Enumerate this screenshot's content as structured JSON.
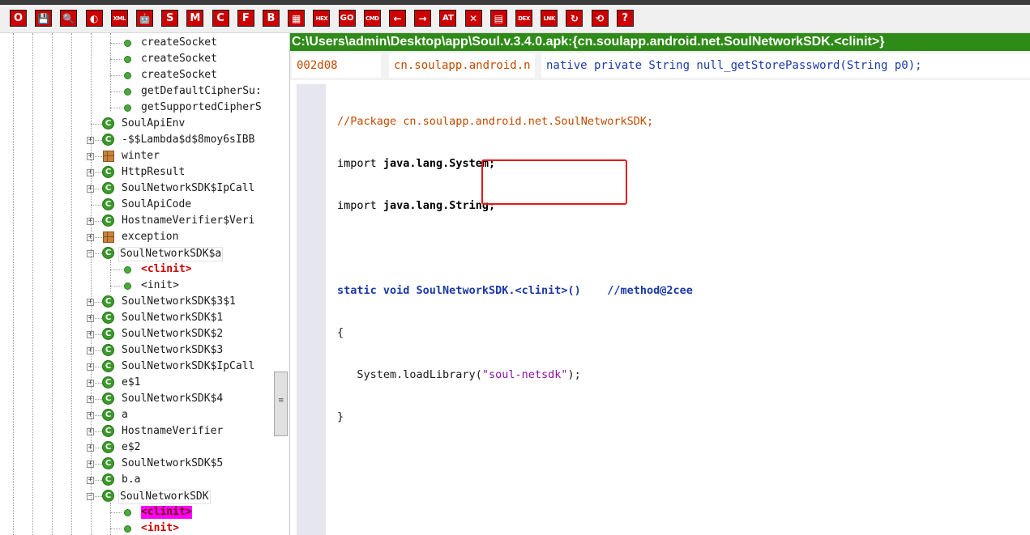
{
  "toolbar": {
    "buttons": [
      {
        "label": "O",
        "name": "open-button"
      },
      {
        "label": "💾",
        "name": "save-icon"
      },
      {
        "label": "🔍",
        "name": "search-icon"
      },
      {
        "label": "◐",
        "name": "toggle-icon"
      },
      {
        "label": "XML",
        "name": "xml-button"
      },
      {
        "label": "🤖",
        "name": "android-icon"
      },
      {
        "label": "S",
        "name": "s-button"
      },
      {
        "label": "M",
        "name": "m-button"
      },
      {
        "label": "C",
        "name": "c-button"
      },
      {
        "label": "F",
        "name": "f-button"
      },
      {
        "label": "B",
        "name": "b-button"
      },
      {
        "label": "▦",
        "name": "grid-icon"
      },
      {
        "label": "HEX",
        "name": "hex-button"
      },
      {
        "label": "GO",
        "name": "go-button"
      },
      {
        "label": "CMD",
        "name": "cmd-button"
      },
      {
        "label": "←",
        "name": "back-arrow-icon"
      },
      {
        "label": "→",
        "name": "forward-arrow-icon"
      },
      {
        "label": "AT",
        "name": "at-button"
      },
      {
        "label": "✕",
        "name": "tools-icon"
      },
      {
        "label": "▤",
        "name": "list-icon"
      },
      {
        "label": "DEX",
        "name": "dex-button"
      },
      {
        "label": "LNK",
        "name": "link-button"
      },
      {
        "label": "↻",
        "name": "refresh-icon"
      },
      {
        "label": "⟲",
        "name": "undo-icon"
      },
      {
        "label": "?",
        "name": "help-icon"
      }
    ]
  },
  "tree": {
    "items": [
      {
        "label": "createSocket",
        "kind": "method"
      },
      {
        "label": "createSocket",
        "kind": "method"
      },
      {
        "label": "createSocket",
        "kind": "method"
      },
      {
        "label": "getDefaultCipherSu:",
        "kind": "method"
      },
      {
        "label": "getSupportedCipherS",
        "kind": "method"
      },
      {
        "label": "SoulApiEnv",
        "kind": "class"
      },
      {
        "label": "-$$Lambda$d$8moy6sIBB",
        "kind": "class"
      },
      {
        "label": "winter",
        "kind": "package"
      },
      {
        "label": "HttpResult",
        "kind": "class"
      },
      {
        "label": "SoulNetworkSDK$IpCall",
        "kind": "class"
      },
      {
        "label": "SoulApiCode",
        "kind": "class"
      },
      {
        "label": "HostnameVerifier$Veri",
        "kind": "class"
      },
      {
        "label": "exception",
        "kind": "package"
      },
      {
        "label": "SoulNetworkSDK$a",
        "kind": "class"
      },
      {
        "label": "<clinit>",
        "kind": "method"
      },
      {
        "label": "<init>",
        "kind": "method"
      },
      {
        "label": "SoulNetworkSDK$3$1",
        "kind": "class"
      },
      {
        "label": "SoulNetworkSDK$1",
        "kind": "class"
      },
      {
        "label": "SoulNetworkSDK$2",
        "kind": "class"
      },
      {
        "label": "SoulNetworkSDK$3",
        "kind": "class"
      },
      {
        "label": "SoulNetworkSDK$IpCall",
        "kind": "class"
      },
      {
        "label": "e$1",
        "kind": "class"
      },
      {
        "label": "SoulNetworkSDK$4",
        "kind": "class"
      },
      {
        "label": "a",
        "kind": "class"
      },
      {
        "label": "HostnameVerifier",
        "kind": "class"
      },
      {
        "label": "e$2",
        "kind": "class"
      },
      {
        "label": "SoulNetworkSDK$5",
        "kind": "class"
      },
      {
        "label": "b.a",
        "kind": "class"
      },
      {
        "label": "SoulNetworkSDK",
        "kind": "class"
      },
      {
        "label": "<clinit>",
        "kind": "method"
      },
      {
        "label": "<init>",
        "kind": "method"
      }
    ],
    "class_icon": "C",
    "expand_glyph": "+",
    "collapse_glyph": "−",
    "scroll_grip": "≡"
  },
  "pathbar": {
    "text": "C:\\Users\\admin\\Desktop\\app\\Soul.v.3.4.0.apk:{cn.soulapp.android.net.SoulNetworkSDK.<clinit>}"
  },
  "infobar": {
    "offset": "002d08",
    "package": "cn.soulapp.android.n",
    "signature": "native private String null_getStorePassword(String p0);"
  },
  "code": {
    "package_comment": "//Package cn.soulapp.android.net.SoulNetworkSDK;",
    "import_kw": "import",
    "import1": "java.lang.System;",
    "import2": "java.lang.String;",
    "method_mods": "static void",
    "method_name": "SoulNetworkSDK.<clinit>()",
    "method_comment": "//method@2cee",
    "open_brace": "{",
    "call": "System.loadLibrary(",
    "string_literal": "\"soul-netsdk\"",
    "call_end": ");",
    "close_brace": "}"
  },
  "colors": {
    "toolbar_button": "#cc0000",
    "pathbar": "#2e8b17",
    "highlight": "#ff00ff",
    "annotation_box": "#e81818"
  }
}
